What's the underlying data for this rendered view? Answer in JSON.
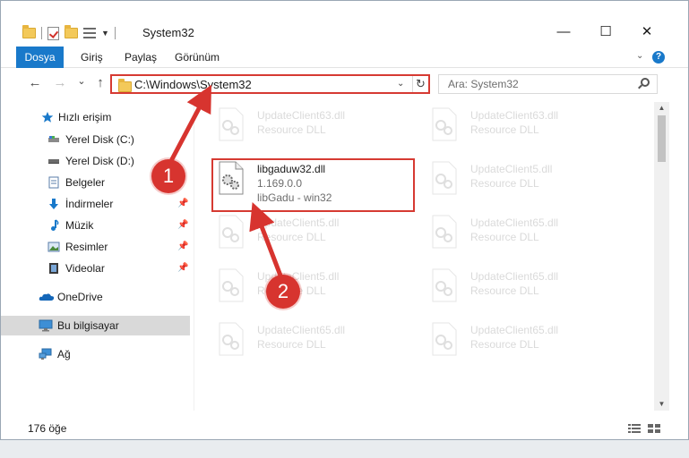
{
  "window": {
    "title": "System32",
    "controls": {
      "minimize": "—",
      "maximize": "☐",
      "close": "✕"
    }
  },
  "ribbon": {
    "tabs": [
      "Dosya",
      "Giriş",
      "Paylaş",
      "Görünüm"
    ],
    "help": "?"
  },
  "navigation": {
    "back": "←",
    "forward": "→",
    "recent": "⌄",
    "up": "↑",
    "address": "C:\\Windows\\System32",
    "search_placeholder": "Ara: System32"
  },
  "sidebar": {
    "items": [
      {
        "label": "Hızlı erişim",
        "icon": "star-icon"
      },
      {
        "label": "Yerel Disk (C:)",
        "icon": "drive-icon"
      },
      {
        "label": "Yerel Disk (D:)",
        "icon": "drive-icon"
      },
      {
        "label": "Belgeler",
        "icon": "documents-icon"
      },
      {
        "label": "İndirmeler",
        "icon": "downloads-icon"
      },
      {
        "label": "Müzik",
        "icon": "music-icon"
      },
      {
        "label": "Resimler",
        "icon": "pictures-icon"
      },
      {
        "label": "Videolar",
        "icon": "videos-icon"
      },
      {
        "label": "OneDrive",
        "icon": "onedrive-icon"
      },
      {
        "label": "Bu bilgisayar",
        "icon": "computer-icon"
      },
      {
        "label": "Ağ",
        "icon": "network-icon"
      }
    ]
  },
  "files": [
    {
      "name": "UpdateClient63.dll",
      "desc": "Resource DLL"
    },
    {
      "name": "UpdateClient63.dll",
      "desc": "Resource DLL"
    },
    {
      "name": "libgaduw32.dll",
      "desc": "1.169.0.0",
      "desc2": "libGadu - win32"
    },
    {
      "name": "UpdateClient5.dll",
      "desc": "Resource DLL"
    },
    {
      "name": "UpdateClient5.dll",
      "desc": "Resource DLL"
    },
    {
      "name": "UpdateClient65.dll",
      "desc": "Resource DLL"
    },
    {
      "name": "UpdateClient5.dll",
      "desc": "Resource DLL"
    },
    {
      "name": "UpdateClient65.dll",
      "desc": "Resource DLL"
    },
    {
      "name": "UpdateClient65.dll",
      "desc": "Resource DLL"
    },
    {
      "name": "UpdateClient65.dll",
      "desc": "Resource DLL"
    }
  ],
  "status": {
    "count": "176 öğe"
  },
  "annotations": {
    "step1": "1",
    "step2": "2"
  },
  "colors": {
    "accent": "#1979ca",
    "annotation": "#d63a32"
  }
}
